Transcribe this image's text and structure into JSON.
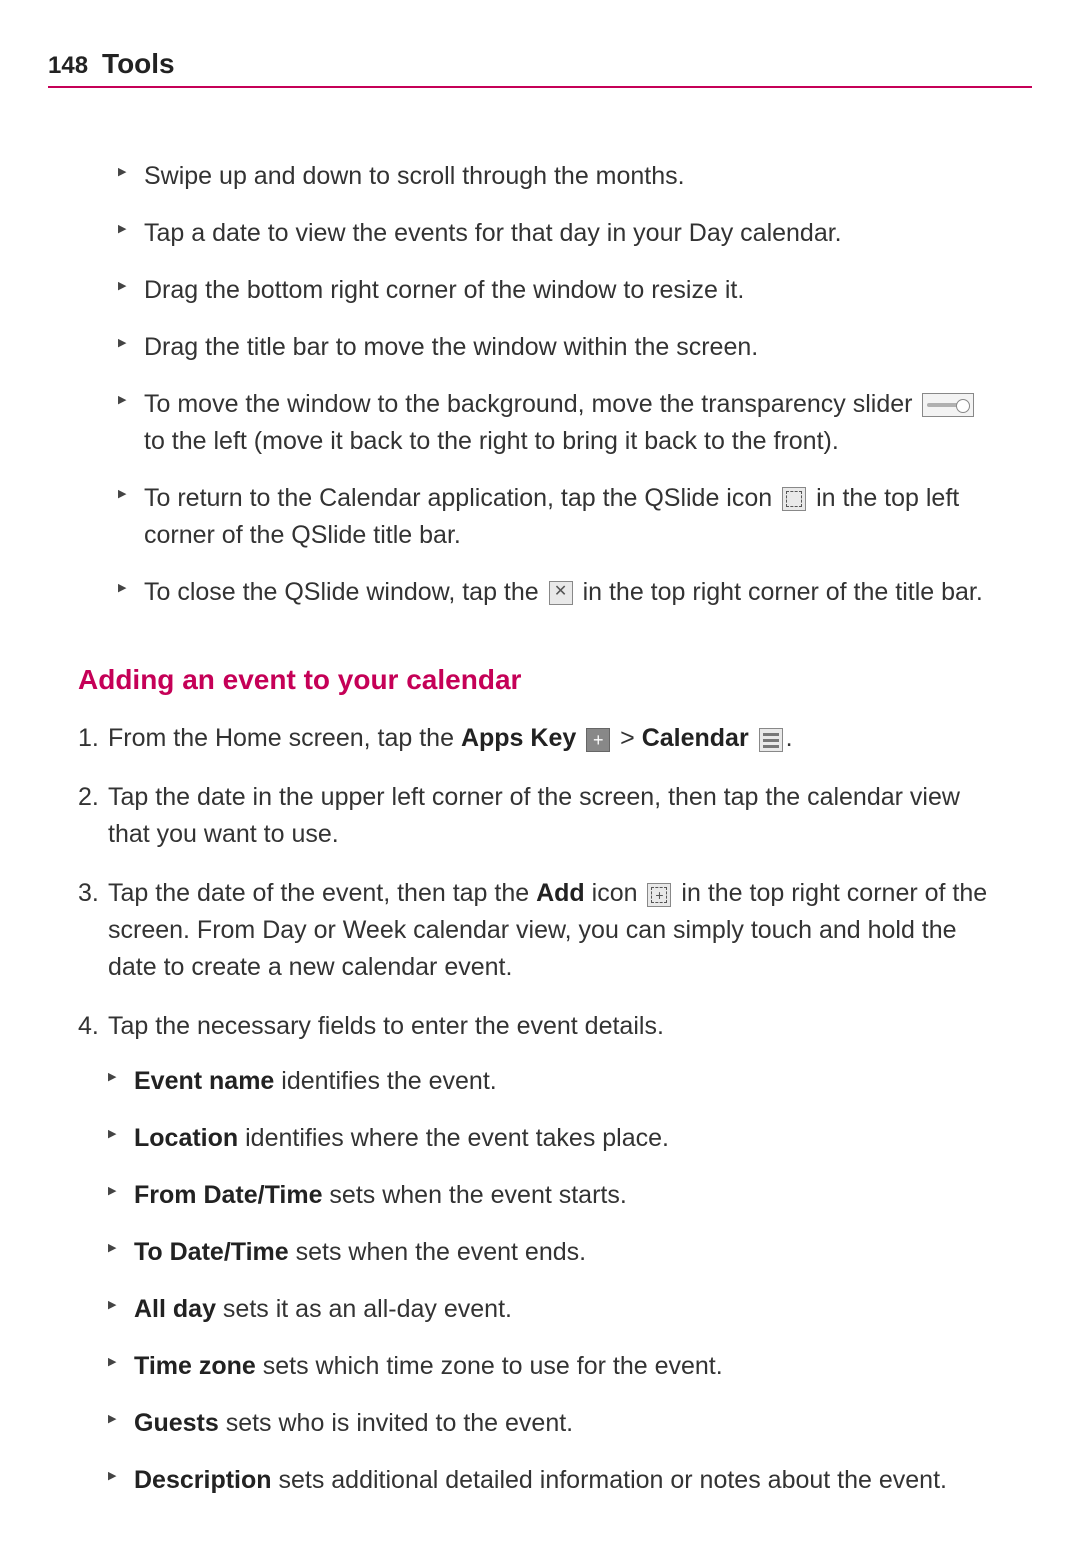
{
  "header": {
    "page_number": "148",
    "title": "Tools"
  },
  "bullets": [
    "Swipe up and down to scroll through the months.",
    "Tap a date to view the events for that day in your Day calendar.",
    "Drag the bottom right corner of the window to resize it.",
    "Drag the title bar to move the window within the screen."
  ],
  "bullet_slider": {
    "pre": "To move the window to the background, move the transparency slider ",
    "post": " to the left (move it back to the right to bring it back to the front)."
  },
  "bullet_qslide": {
    "pre": "To return to the Calendar application, tap the QSlide icon ",
    "post": " in the top left corner of the QSlide title bar."
  },
  "bullet_close": {
    "pre": "To close the QSlide window, tap the ",
    "post": " in the top right corner of the title bar."
  },
  "subheading": "Adding an event to your calendar",
  "step1": {
    "pre": "From the Home screen, tap the ",
    "bold1": "Apps Key",
    "mid": " > ",
    "bold2": "Calendar",
    "post": "."
  },
  "step2": "Tap the date in the upper left corner of the screen, then tap the calendar view that you want to use.",
  "step3": {
    "pre": "Tap the date of the event, then tap the ",
    "bold": "Add",
    "mid": " icon ",
    "post": " in the top right corner of the screen. From Day or Week calendar view, you can simply touch and hold the date to create a new calendar event."
  },
  "step4": {
    "intro": "Tap the necessary fields to enter the event details.",
    "fields": [
      {
        "name": "Event name",
        "desc": " identifies the event."
      },
      {
        "name": "Location",
        "desc": " identifies where the event takes place."
      },
      {
        "name": "From Date/Time",
        "desc": " sets when the event starts."
      },
      {
        "name": "To Date/Time",
        "desc": " sets when the event ends."
      },
      {
        "name": "All day",
        "desc": " sets it as an all-day event."
      },
      {
        "name": "Time zone",
        "desc": " sets which time zone to use for the event."
      },
      {
        "name": "Guests",
        "desc": " sets who is invited to the event."
      },
      {
        "name": "Description",
        "desc": " sets additional detailed information or notes about the event."
      }
    ]
  },
  "icons": {
    "close_glyph": "✕"
  }
}
